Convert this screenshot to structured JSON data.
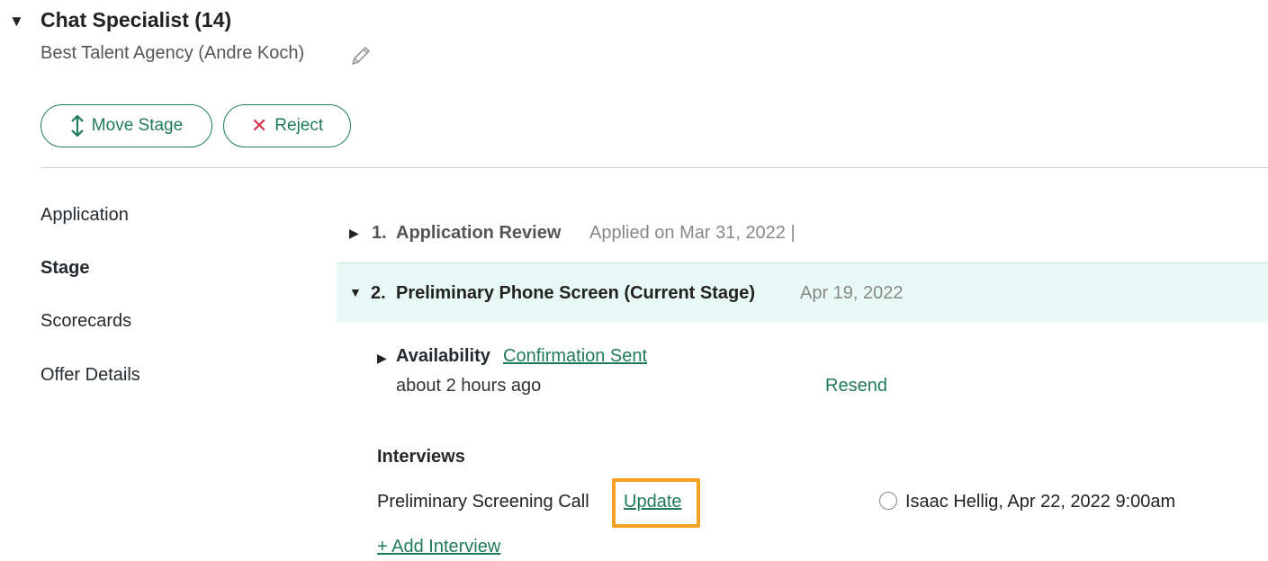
{
  "job": {
    "title": "Chat Specialist (14)",
    "agency": "Best Talent Agency (Andre Koch)"
  },
  "actions": {
    "move_stage": "Move Stage",
    "reject": "Reject"
  },
  "sidebar": {
    "items": [
      {
        "label": "Application"
      },
      {
        "label": "Stage"
      },
      {
        "label": "Scorecards"
      },
      {
        "label": "Offer Details"
      }
    ]
  },
  "stages": [
    {
      "number": "1.",
      "name": "Application Review",
      "date": "Applied on Mar 31, 2022 |"
    },
    {
      "number": "2.",
      "name": "Preliminary Phone Screen (Current Stage)",
      "date": "Apr 19, 2022"
    }
  ],
  "availability": {
    "label": "Availability",
    "status": "Confirmation Sent",
    "time": "about 2 hours ago",
    "resend": "Resend"
  },
  "interviews": {
    "heading": "Interviews",
    "items": [
      {
        "name": "Preliminary Screening Call",
        "update": "Update",
        "detail": "Isaac Hellig, Apr 22, 2022 9:00am"
      }
    ],
    "add": "+ Add Interview"
  },
  "colors": {
    "accent": "#1f7a5c",
    "reject": "#d7344b",
    "current_stage_bg": "#e8f8f4",
    "highlight": "#f5a020"
  },
  "icons": {
    "job_toggle": "triangle-down-icon",
    "edit": "pencil-icon",
    "move_stage": "up-down-arrow-icon",
    "reject": "x-icon",
    "stage_collapsed": "triangle-right-icon",
    "stage_expanded": "triangle-down-icon"
  }
}
